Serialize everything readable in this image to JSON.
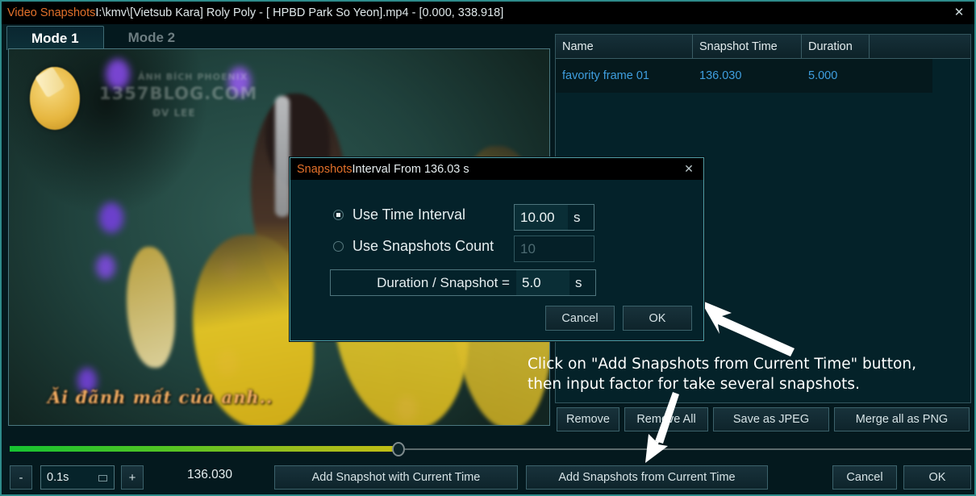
{
  "window": {
    "title_accent": "Video Snapshots",
    "title_path": "I:\\kmv\\[Vietsub Kara] Roly Poly - [ HPBD Park So Yeon].mp4 - [0.000, 338.918]",
    "close_icon": "✕"
  },
  "tabs": [
    {
      "label": "Mode 1",
      "active": true
    },
    {
      "label": "Mode 2",
      "active": false
    }
  ],
  "video": {
    "subtitle_text": "Ăi đãnh mất của anh..",
    "watermark_line1": "ẢNH BÍCH PHOENIX",
    "watermark_line2": "1357BLOG.COM",
    "watermark_line3": "ĐV  LEE"
  },
  "table": {
    "columns": [
      "Name",
      "Snapshot Time",
      "Duration",
      ""
    ],
    "rows": [
      {
        "name": "favority frame 01",
        "snapshot_time": "136.030",
        "duration": "5.000",
        "extra": ""
      }
    ]
  },
  "toolbar": {
    "remove": "Remove",
    "remove_all": "Remove All",
    "save_jpeg": "Save as JPEG",
    "merge_png": "Merge all as PNG"
  },
  "seek": {
    "position_percent": 40,
    "fill_start_color": "#16c231",
    "fill_end_color": "#c2bd14"
  },
  "bottom": {
    "minus": "-",
    "plus": "+",
    "step_value": "0.1s",
    "current_time": "136.030",
    "add_snapshot": "Add Snapshot with Current Time",
    "add_snapshots": "Add Snapshots from Current Time",
    "cancel": "Cancel",
    "ok": "OK"
  },
  "dialog": {
    "title_accent": "Snapshots",
    "title_rest": " Interval From 136.03 s",
    "close_icon": "✕",
    "option_time_interval": "Use Time Interval",
    "option_snapshots_count": "Use Snapshots Count",
    "time_interval_value": "10.00",
    "time_interval_unit": "s",
    "snapshots_count_placeholder": "10",
    "duration_label": "Duration / Snapshot =",
    "duration_value": "5.0",
    "duration_unit": "s",
    "cancel": "Cancel",
    "ok": "OK",
    "selected_option": "time_interval"
  },
  "annotation": {
    "line1": "Click on \"Add Snapshots from Current Time\" button,",
    "line2": "then input factor for take several snapshots."
  },
  "colors": {
    "accent_orange": "#e2702a",
    "link_blue": "#3f9fe0",
    "panel_bg": "#042229",
    "border_teal": "#4fa0a8"
  }
}
